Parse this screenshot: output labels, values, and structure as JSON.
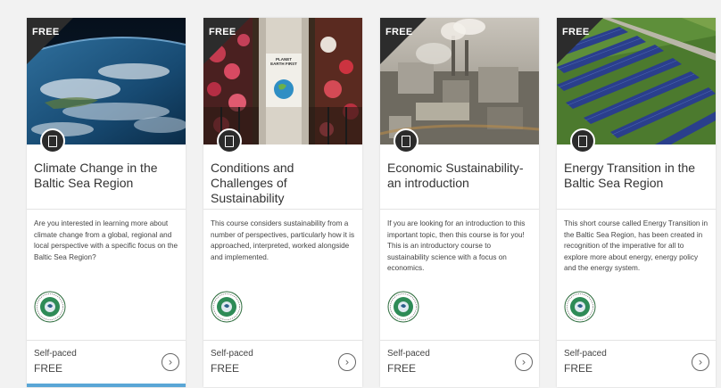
{
  "ribbon_color": "#2c2c2c",
  "accent_color": "#5aa6d6",
  "cards": [
    {
      "badge": "FREE",
      "type_icon": "book-icon",
      "title": "Climate Change in the Baltic Sea Region",
      "description": "Are you interested in learning more about climate change from a global, regional and local perspective with a specific focus on the Baltic Sea Region?",
      "pace": "Self-paced",
      "price": "FREE",
      "arrow": "›"
    },
    {
      "badge": "FREE",
      "type_icon": "book-icon",
      "title": "Conditions and Challenges of Sustainability",
      "image_text": "PLANET EARTH FIRST",
      "description": "This course considers sustainability from a number of perspectives, particularly how it is approached, interpreted, worked alongside and implemented.",
      "pace": "Self-paced",
      "price": "FREE",
      "arrow": "›"
    },
    {
      "badge": "FREE",
      "type_icon": "book-icon",
      "title": "Economic Sustainability- an introduction",
      "description": "If you are looking for an introduction to this important topic, then this course is for you! This is an introductory course to sustainability science with a focus on economics.",
      "pace": "Self-paced",
      "price": "FREE",
      "arrow": "›"
    },
    {
      "badge": "FREE",
      "type_icon": "book-icon",
      "title": "Energy Transition in the Baltic Sea Region",
      "description": "This short course called Energy Transition in the Baltic Sea Region, has been created in recognition of the imperative for all to explore more about energy, energy policy and the energy system.",
      "pace": "Self-paced",
      "price": "FREE",
      "arrow": "›"
    }
  ]
}
